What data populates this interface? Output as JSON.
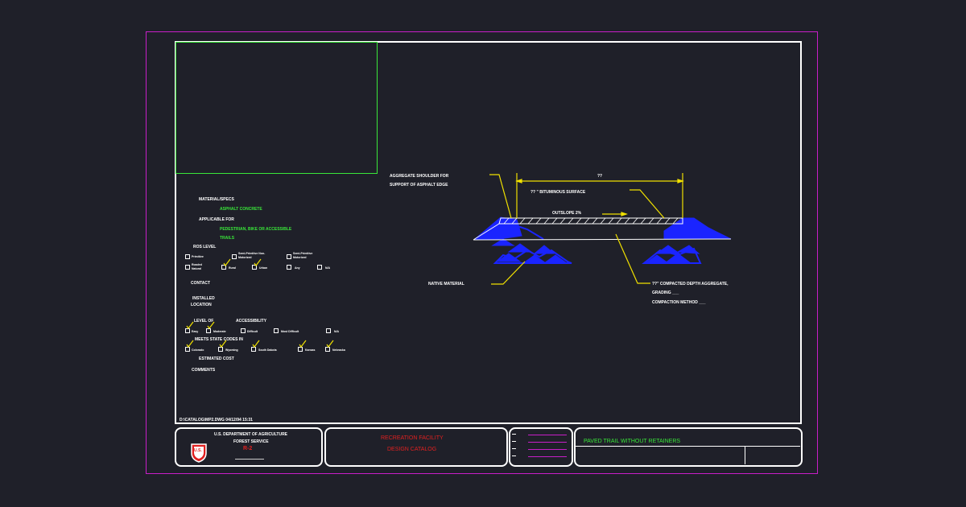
{
  "specs": {
    "material_specs_label": "MATERIAL/SPECS",
    "material_value": "ASPHALT CONCRETE",
    "applicable_label": "APPLICABLE FOR",
    "applicable_value_1": "PEDESTRIAN, BIKE OR ACCESSIBLE",
    "applicable_value_2": "TRAILS",
    "ros_label": "ROS LEVEL",
    "ros_options": [
      "Primitive",
      "Semi-Primitive Non-Motorized",
      "Semi-Primitive Motorized",
      "Roaded Natural",
      "Rural",
      "Urban",
      "Any",
      "N/A"
    ],
    "contact_label": "CONTACT",
    "installed_label_1": "INSTALLED",
    "installed_label_2": "LOCATION",
    "level_of_label": "LEVEL OF",
    "accessibility_label": "ACCESSIBILITY",
    "access_options": [
      "Easy",
      "Moderate",
      "Difficult",
      "Most Difficult",
      "N/A"
    ],
    "state_codes_label": "MEETS STATE CODES IN",
    "states": [
      "Colorado",
      "Wyoming",
      "South Dakota",
      "Kansas",
      "Nebraska"
    ],
    "cost_label": "ESTIMATED COST",
    "comments_label": "COMMENTS",
    "file_path": "D:\\CATALOG\\MP2.DWG 04/12/94 15:31"
  },
  "drawing": {
    "shoulder_label_1": "AGGREGATE SHOULDER FOR",
    "shoulder_label_2": "SUPPORT OF ASPHALT EDGE",
    "width_dim": "??",
    "surface_label": "?? \" BITUMINOUS SURFACE",
    "outslope_label": "OUTSLOPE 2%",
    "native_label": "NATIVE MATERIAL",
    "aggregate_label_1": "??\" COMPACTED DEPTH AGGREGATE,",
    "aggregate_label_2": "GRADING ___",
    "aggregate_label_3": "COMPACTION METHOD ___"
  },
  "title_block": {
    "dept": "U.S. DEPARTMENT OF AGRICULTURE",
    "service": "FOREST SERVICE",
    "region": "R-2",
    "logo_text": "U.S.",
    "catalog_line1": "RECREATION FACILITY",
    "catalog_line2": "DESIGN CATALOG",
    "drawing_title": "PAVED TRAIL WITHOUT RETAINERS"
  },
  "colors": {
    "background": "#1f2029",
    "magenta_frame": "#c81ec8",
    "green": "#39e639",
    "yellow": "#f0e000",
    "blue": "#1a24ff",
    "red": "#e02020"
  }
}
